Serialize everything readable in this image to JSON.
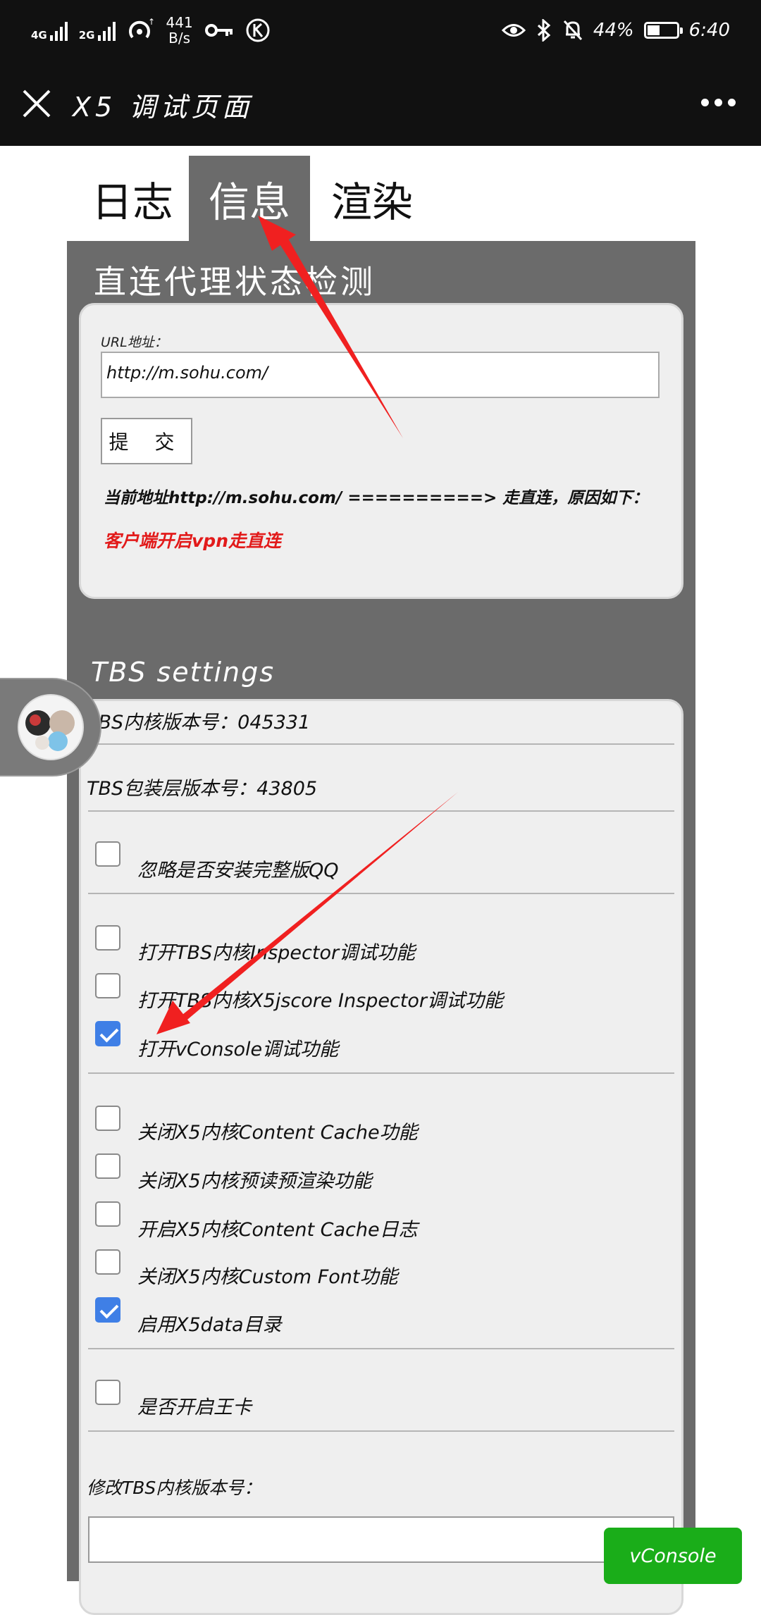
{
  "statusbar": {
    "net1": "4G",
    "net2": "2G",
    "speed_value": "441",
    "speed_unit": "B/s",
    "battery_percent": "44%",
    "battery_level": 0.44,
    "time": "6:40",
    "icons": [
      "signal-icon",
      "wifi-hotspot-icon",
      "key-icon",
      "k-circle-icon",
      "eye-icon",
      "bluetooth-icon",
      "mute-icon",
      "battery-icon"
    ]
  },
  "titlebar": {
    "title": "X5 调试页面",
    "close_icon": "close-icon",
    "more_icon": "more-icon"
  },
  "tabs": [
    {
      "label": "日志",
      "active": false
    },
    {
      "label": "信息",
      "active": true
    },
    {
      "label": "渲染",
      "active": false
    }
  ],
  "proxy": {
    "title": "直连代理状态检测",
    "url_label": "URL地址：",
    "url_value": "http://m.sohu.com/",
    "submit_label": "提 交",
    "result_line": "当前地址http://m.sohu.com/ ==========> 走直连，原因如下：",
    "reason": "客户端开启vpn走直连"
  },
  "tbs": {
    "title": "TBS settings",
    "core_version": "TBS内核版本号：045331",
    "shell_version": "TBS包装层版本号：43805",
    "options": [
      {
        "label": "忽略是否安装完整版QQ",
        "checked": false
      },
      {
        "label": "打开TBS内核Inspector调试功能",
        "checked": false
      },
      {
        "label": "打开TBS内核X5jscore Inspector调试功能",
        "checked": false
      },
      {
        "label": "打开vConsole调试功能",
        "checked": true
      },
      {
        "label": "关闭X5内核Content Cache功能",
        "checked": false
      },
      {
        "label": "关闭X5内核预读预渲染功能",
        "checked": false
      },
      {
        "label": "开启X5内核Content Cache日志",
        "checked": false
      },
      {
        "label": "关闭X5内核Custom Font功能",
        "checked": false
      },
      {
        "label": "启用X5data目录",
        "checked": true
      },
      {
        "label": "是否开启王卡",
        "checked": false
      }
    ],
    "modify_label": "修改TBS内核版本号："
  },
  "vconsole": {
    "label": "vConsole"
  },
  "colors": {
    "accent_green": "#1aad19",
    "panel_grey": "#6b6b6b",
    "checkbox_blue": "#3f7fe6",
    "reason_red": "#e21a1a",
    "arrow_red": "#f02020"
  }
}
